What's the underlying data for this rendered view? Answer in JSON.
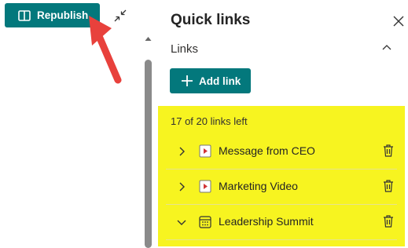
{
  "editor": {
    "republish_label": "Republish"
  },
  "panel": {
    "title": "Quick links",
    "section_label": "Links",
    "add_link_label": "Add link",
    "links_left_text": "17 of 20 links left",
    "links": [
      {
        "label": "Message from CEO",
        "icon": "video-icon",
        "expanded": false
      },
      {
        "label": "Marketing Video",
        "icon": "video-icon",
        "expanded": false
      },
      {
        "label": "Leadership Summit",
        "icon": "calendar-icon",
        "expanded": true
      }
    ]
  },
  "colors": {
    "accent": "#03787c",
    "highlight": "#f7f420",
    "annotation_arrow": "#e8413c",
    "video_icon": "#d13438"
  }
}
